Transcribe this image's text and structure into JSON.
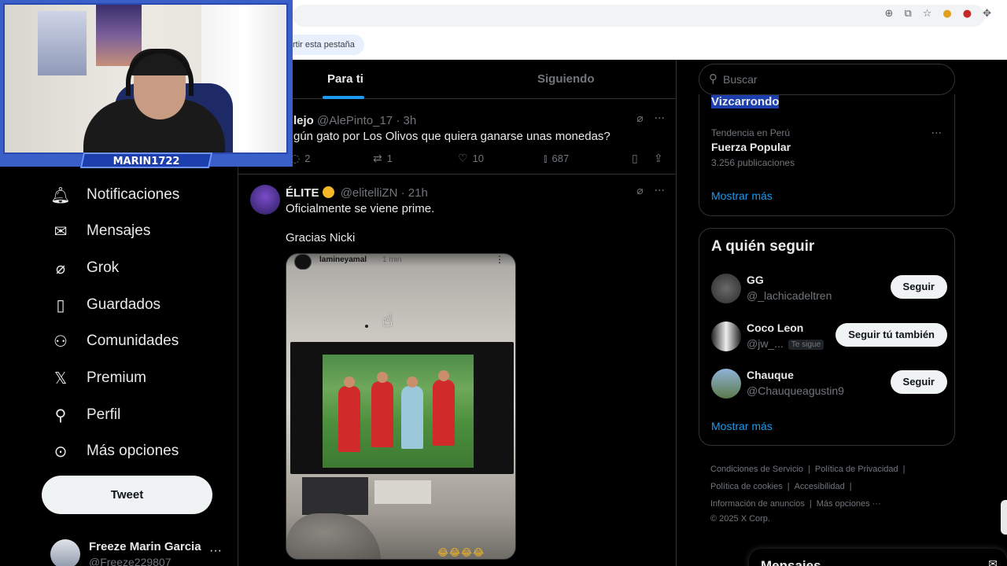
{
  "browser": {
    "bookmark_chip": "rtir esta pestaña",
    "chrome_icons": [
      "zoom-icon",
      "cast-icon",
      "star-icon",
      "extension-icon",
      "puzzle-icon"
    ]
  },
  "webcam": {
    "name": "MARIN1722"
  },
  "nav": {
    "items": [
      {
        "label": "Notificaciones",
        "icon": "bell-icon"
      },
      {
        "label": "Mensajes",
        "icon": "envelope-icon"
      },
      {
        "label": "Grok",
        "icon": "grok-icon"
      },
      {
        "label": "Guardados",
        "icon": "bookmark-icon"
      },
      {
        "label": "Comunidades",
        "icon": "communities-icon"
      },
      {
        "label": "Premium",
        "icon": "x-logo-icon"
      },
      {
        "label": "Perfil",
        "icon": "person-icon"
      },
      {
        "label": "Más opciones",
        "icon": "more-circle-icon"
      }
    ],
    "tweet_label": "Tweet",
    "account": {
      "name": "Freeze Marin Garcia",
      "handle": "@Freeze229807",
      "more": "···"
    }
  },
  "tabs": {
    "for_you": "Para ti",
    "following": "Siguiendo"
  },
  "post1": {
    "name": "lejo",
    "handle": "@AlePinto_17",
    "time": "· 3h",
    "text": "gún gato por Los Olivos que quiera ganarse unas monedas?",
    "replies": "2",
    "reposts": "1",
    "likes": "10",
    "views": "687"
  },
  "post2": {
    "name": "ÉLITE",
    "handle": "@elitelliZN",
    "time": "· 21h",
    "line1": "Oficialmente se viene prime.",
    "line2": "Gracias Nicki",
    "story_user": "lamineyamal",
    "story_time": "1 min",
    "reactions": "😂😂😂😂"
  },
  "search": {
    "placeholder": "Buscar"
  },
  "trends": {
    "top_cut": "Vizcarrondo",
    "meta": "Tendencia en Perú",
    "name": "Fuerza Popular",
    "count": "3.256 publicaciones",
    "show_more": "Mostrar más"
  },
  "who_to_follow": {
    "title": "A quién seguir",
    "users": [
      {
        "name": "GG",
        "handle": "@_lachicadeltren",
        "button": "Seguir",
        "badge": ""
      },
      {
        "name": "Coco Leon",
        "handle": "@jw_...",
        "button": "Seguir tú también",
        "badge": "Te sigue"
      },
      {
        "name": "Chauque",
        "handle": "@Chauqueagustin9",
        "button": "Seguir",
        "badge": ""
      }
    ],
    "show_more": "Mostrar más"
  },
  "footer": {
    "terms": "Condiciones de Servicio",
    "privacy": "Política de Privacidad",
    "cookies": "Política de cookies",
    "accessibility": "Accesibilidad",
    "ads": "Información de anuncios",
    "more": "Más opciones ···",
    "copyright": "© 2025 X Corp."
  },
  "messages": {
    "title": "Mensajes"
  },
  "colors": {
    "accent": "#1d9bf0",
    "background": "#000000",
    "text": "#e7e9ea",
    "muted": "#71767b",
    "border": "#2f3336"
  }
}
